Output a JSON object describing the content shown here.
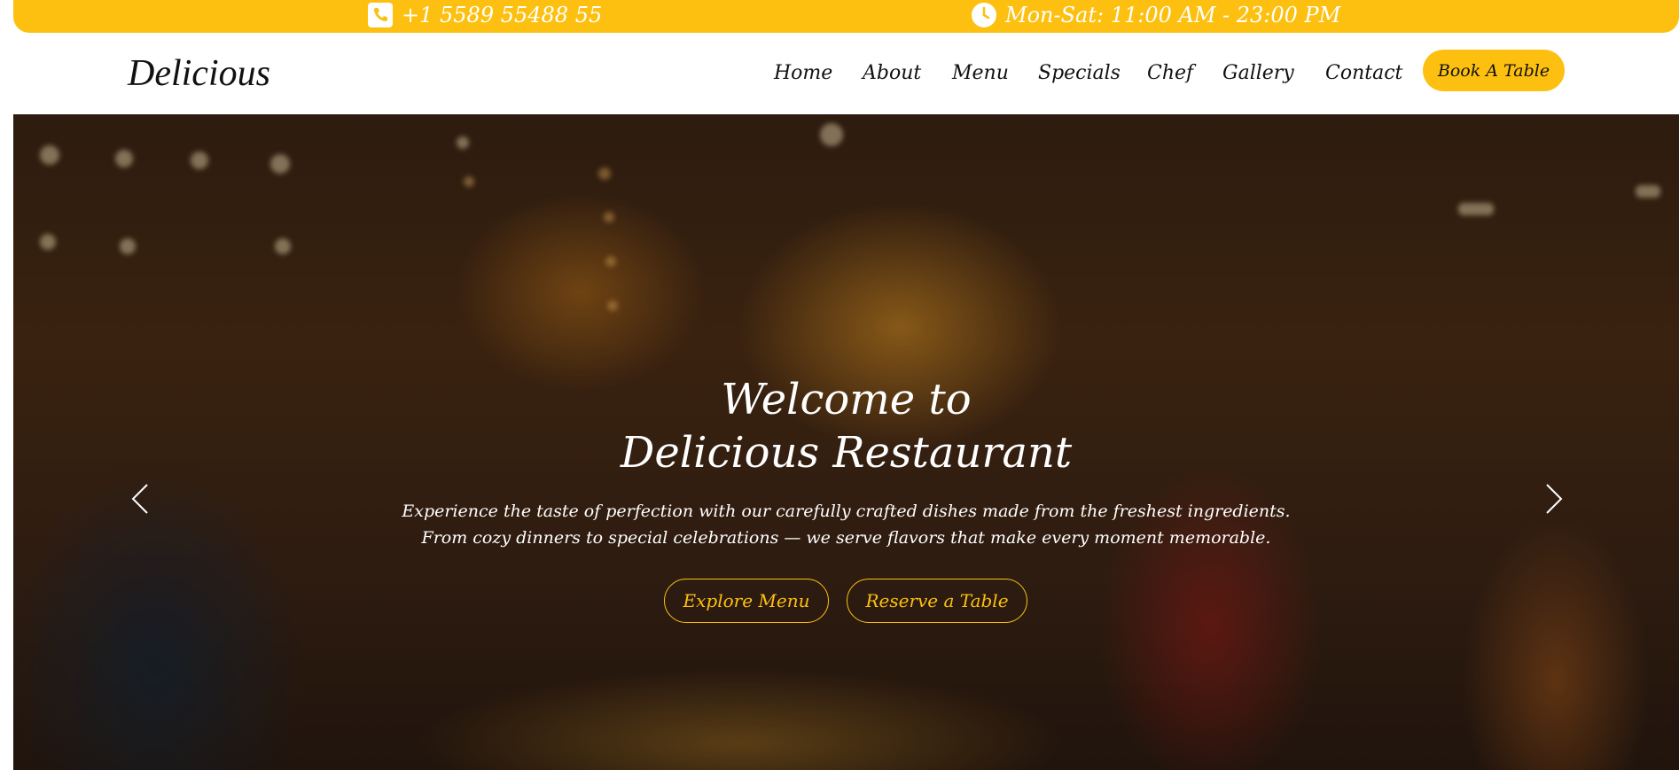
{
  "topbar": {
    "phone": "+1 5589 55488 55",
    "hours": "Mon-Sat: 11:00 AM - 23:00 PM",
    "phone_icon": "phone-icon",
    "hours_icon": "clock-icon"
  },
  "header": {
    "logo": "Delicious",
    "nav": [
      "Home",
      "About",
      "Menu",
      "Specials",
      "Chef",
      "Gallery",
      "Contact"
    ],
    "book_button": "Book A Table"
  },
  "hero": {
    "title_line1": "Welcome to",
    "title_line2": "Delicious Restaurant",
    "subtitle_line1": "Experience the taste of perfection with our carefully crafted dishes made from the freshest ingredients.",
    "subtitle_line2": "From cozy dinners to special celebrations — we serve flavors that make every moment memorable.",
    "primary_button": "Explore Menu",
    "secondary_button": "Reserve a Table",
    "prev_icon": "chevron-left-icon",
    "next_icon": "chevron-right-icon"
  },
  "colors": {
    "accent": "#fdc010",
    "text_dark": "#111111",
    "text_light": "#ffffff"
  }
}
